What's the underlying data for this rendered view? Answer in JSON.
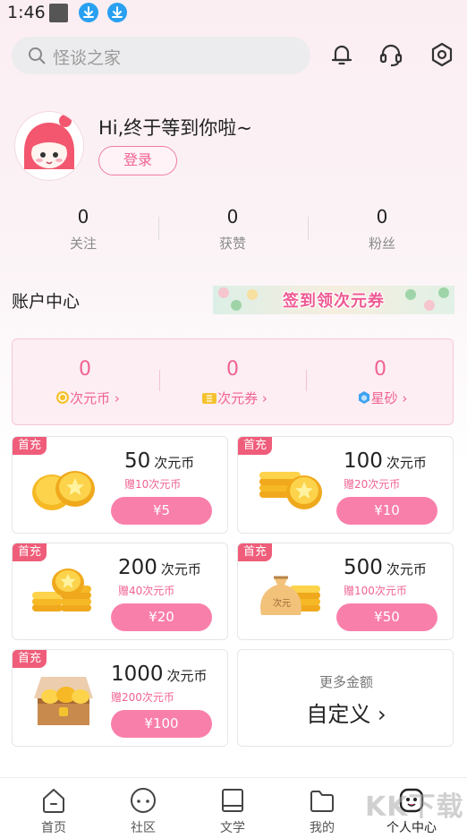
{
  "status_bar": {
    "time": "1:46"
  },
  "header": {
    "search_placeholder": "怪谈之家",
    "icons": [
      "bell-icon",
      "headset-icon",
      "settings-icon"
    ]
  },
  "profile": {
    "greeting": "Hi,终于等到你啦~",
    "login_label": "登录",
    "stats": [
      {
        "value": "0",
        "label": "关注"
      },
      {
        "value": "0",
        "label": "获赞"
      },
      {
        "value": "0",
        "label": "粉丝"
      }
    ]
  },
  "account": {
    "title": "账户中心",
    "banner_text": "签到领次元券",
    "wallet": [
      {
        "value": "0",
        "label": "次元币",
        "icon": "coin-icon"
      },
      {
        "value": "0",
        "label": "次元券",
        "icon": "ticket-icon"
      },
      {
        "value": "0",
        "label": "星砂",
        "icon": "gem-icon"
      }
    ]
  },
  "recharge": {
    "badge": "首充",
    "unit": "次元币",
    "options": [
      {
        "amount": "50",
        "bonus": "赠10次元币",
        "price": "¥5"
      },
      {
        "amount": "100",
        "bonus": "赠20次元币",
        "price": "¥10"
      },
      {
        "amount": "200",
        "bonus": "赠40次元币",
        "price": "¥20"
      },
      {
        "amount": "500",
        "bonus": "赠100次元币",
        "price": "¥50"
      },
      {
        "amount": "1000",
        "bonus": "赠200次元币",
        "price": "¥100"
      }
    ],
    "custom": {
      "subtitle": "更多金额",
      "label": "自定义"
    }
  },
  "bottom_nav": [
    {
      "label": "首页",
      "icon": "home-icon"
    },
    {
      "label": "社区",
      "icon": "community-icon"
    },
    {
      "label": "文学",
      "icon": "book-icon"
    },
    {
      "label": "我的",
      "icon": "folder-icon"
    },
    {
      "label": "个人中心",
      "icon": "profile-icon"
    }
  ],
  "watermark": "KK下载",
  "colors": {
    "accent": "#f06391",
    "button": "#f97fab",
    "badge": "#ef5d7a"
  }
}
